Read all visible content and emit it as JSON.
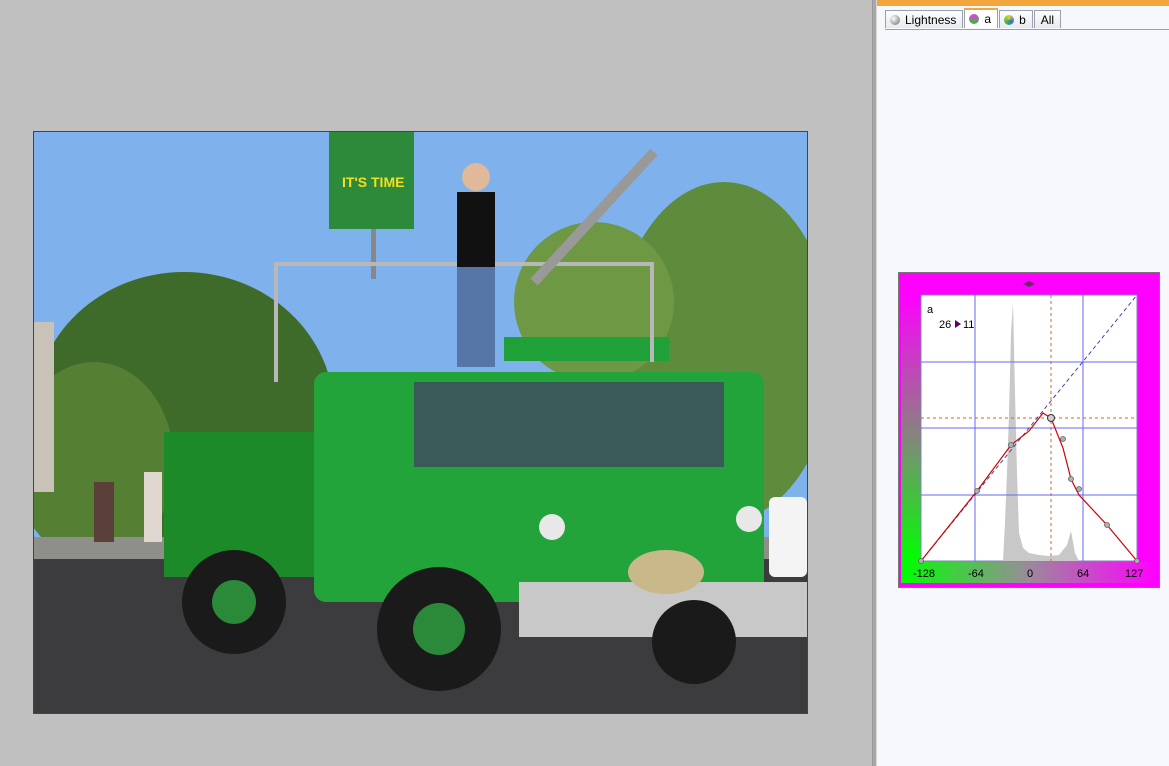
{
  "tabs": [
    {
      "label": "Lightness",
      "icon": "lightness-sphere-icon",
      "color": "#8a8a8a"
    },
    {
      "label": "a",
      "icon": "a-channel-sphere-icon",
      "color": "#c040c0"
    },
    {
      "label": "b",
      "icon": "b-channel-sphere-icon",
      "color": "#d0c030"
    },
    {
      "label": "All",
      "icon": "",
      "color": ""
    }
  ],
  "active_tab": "a",
  "curve": {
    "channel_label": "a",
    "readout_in": "26",
    "readout_out": "11",
    "x_ticks": [
      "-128",
      "-64",
      "0",
      "64",
      "127"
    ],
    "gradient_left": "#00ff00",
    "gradient_right": "#ff00ff"
  },
  "colors": {
    "accent_orange": "#f2a63c",
    "curve_red": "#d00000",
    "grid_blue": "#6666ff"
  }
}
